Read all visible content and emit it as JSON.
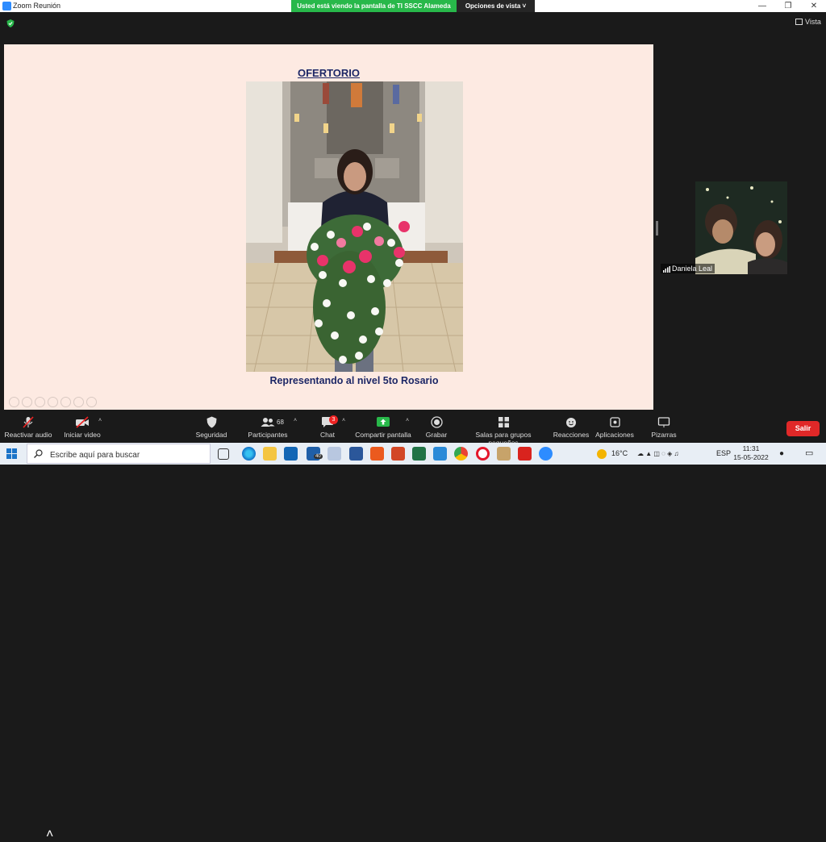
{
  "window": {
    "title": "Zoom Reunión"
  },
  "share_banner": {
    "text": "Usted está viendo la pantalla de TI SSCC Alameda",
    "view_options": "Opciones de vista"
  },
  "view": {
    "label": "Vista"
  },
  "slide": {
    "title": "OFERTORIO",
    "caption": "Representando al nivel 5to Rosario"
  },
  "participant": {
    "name": "Daniela Leal"
  },
  "toolbar": {
    "audio": "Reactivar audio",
    "video": "Iniciar video",
    "security": "Seguridad",
    "participants": "Participantes",
    "participants_count": "68",
    "chat": "Chat",
    "chat_badge": "3",
    "share": "Compartir pantalla",
    "record": "Grabar",
    "breakout": "Salas para grupos pequeños",
    "reactions": "Reacciones",
    "apps": "Aplicaciones",
    "whiteboard": "Pizarras",
    "leave": "Salir"
  },
  "taskbar": {
    "search_placeholder": "Escribe aquí para buscar",
    "mail_badge": "40",
    "temperature": "16°C",
    "language": "ESP",
    "time": "11:31",
    "date": "15-05-2022"
  },
  "colors": {
    "accent_green": "#28b84a",
    "slide_bg": "#fdeae2",
    "slide_text": "#1d2766",
    "leave_red": "#e02828"
  }
}
